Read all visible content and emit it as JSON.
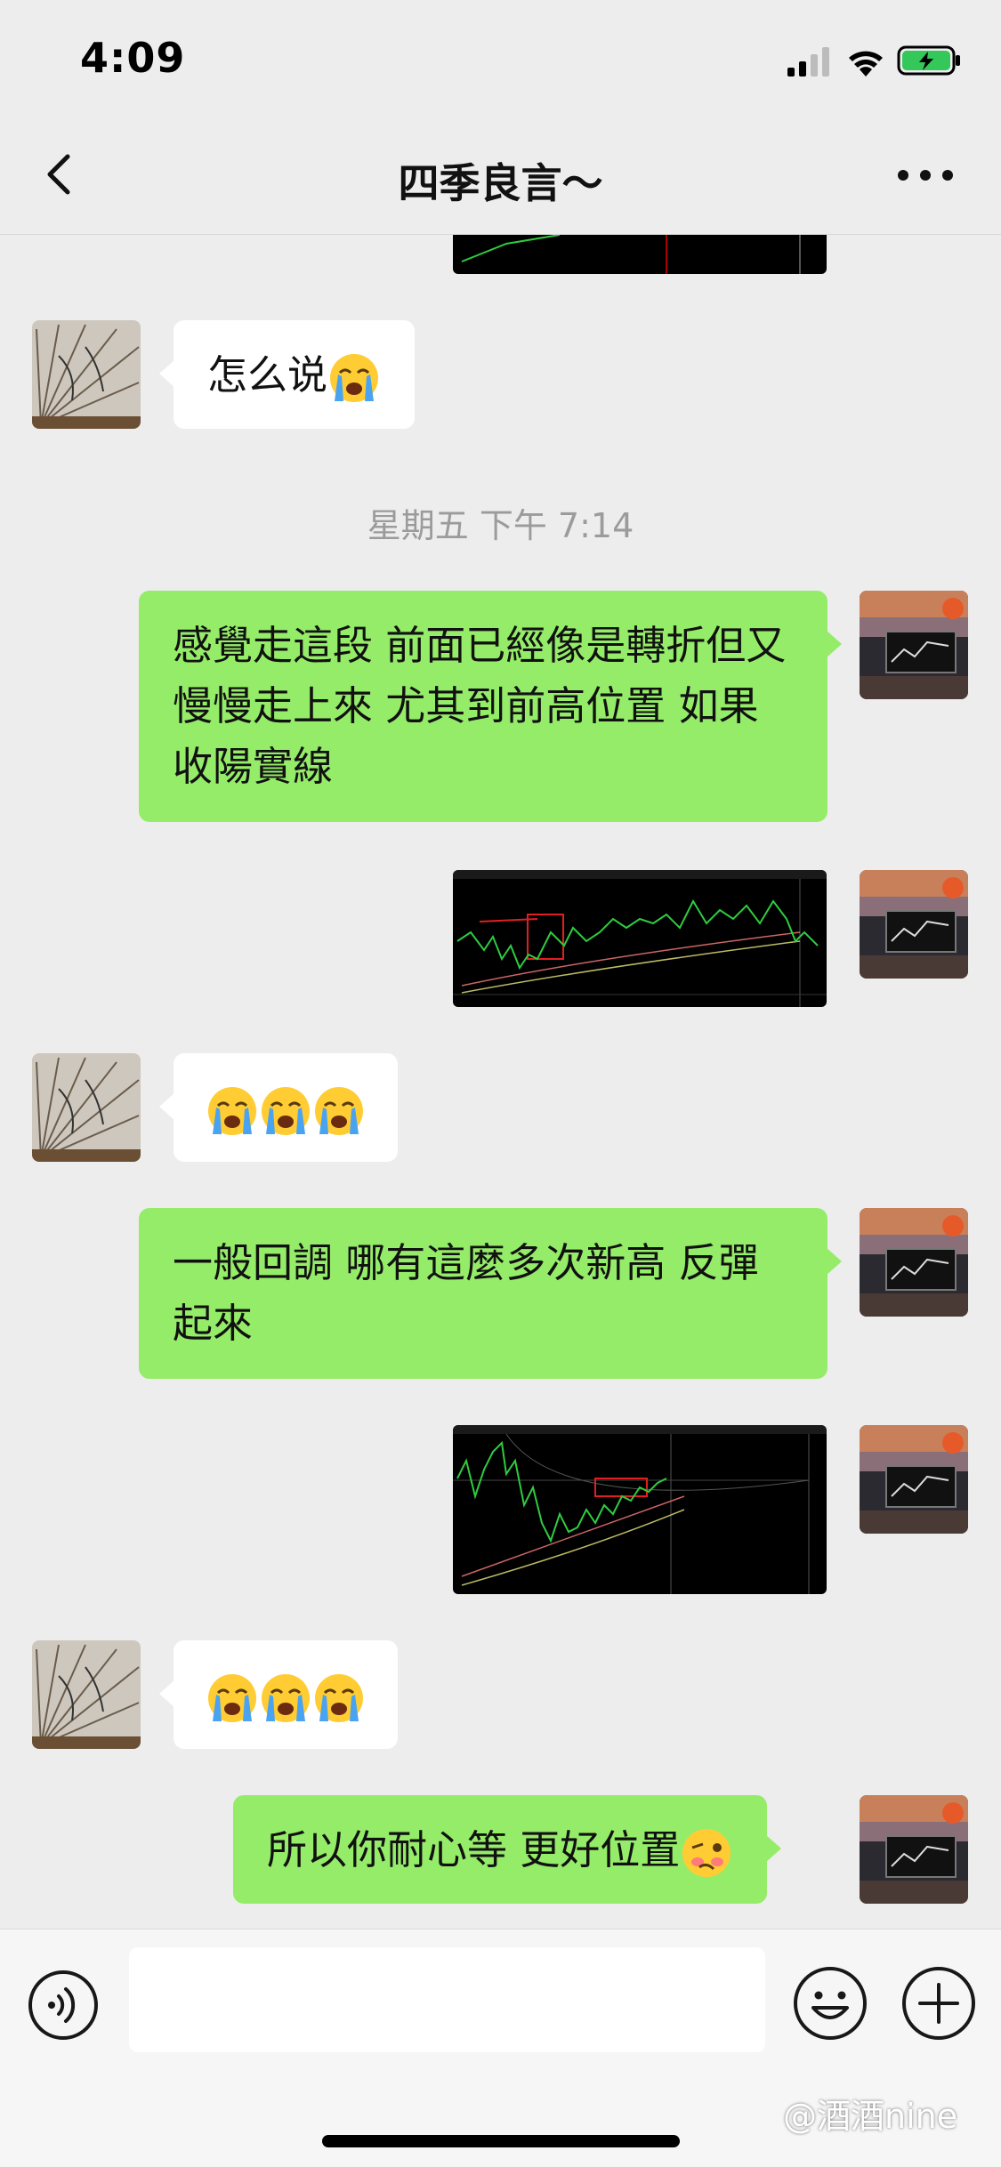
{
  "status_bar": {
    "time": "4:09"
  },
  "nav": {
    "title": "四季良言～"
  },
  "messages": {
    "m1": {
      "text": "怎么说"
    },
    "timestamp": "星期五 下午 7:14",
    "m2": {
      "text": "感覺走這段 前面已經像是轉折但又慢慢走上來 尤其到前高位置 如果收陽實線"
    },
    "m5": {
      "text": "一般回調 哪有這麼多次新高 反彈起來"
    },
    "m8": {
      "text": "所以你耐心等 更好位置"
    }
  },
  "icons": {
    "back": "chevron-left-icon",
    "more": "more-dots-icon",
    "voice": "voice-icon",
    "emoji": "smiley-icon",
    "plus": "plus-icon",
    "crying_emoji": "loudly-crying-face",
    "woozy_emoji": "woozy-face"
  },
  "colors": {
    "background": "#ededed",
    "my_bubble": "#95ec69",
    "other_bubble": "#ffffff",
    "chart_line": "#2ecc40"
  },
  "watermark": "@酒酒nine"
}
